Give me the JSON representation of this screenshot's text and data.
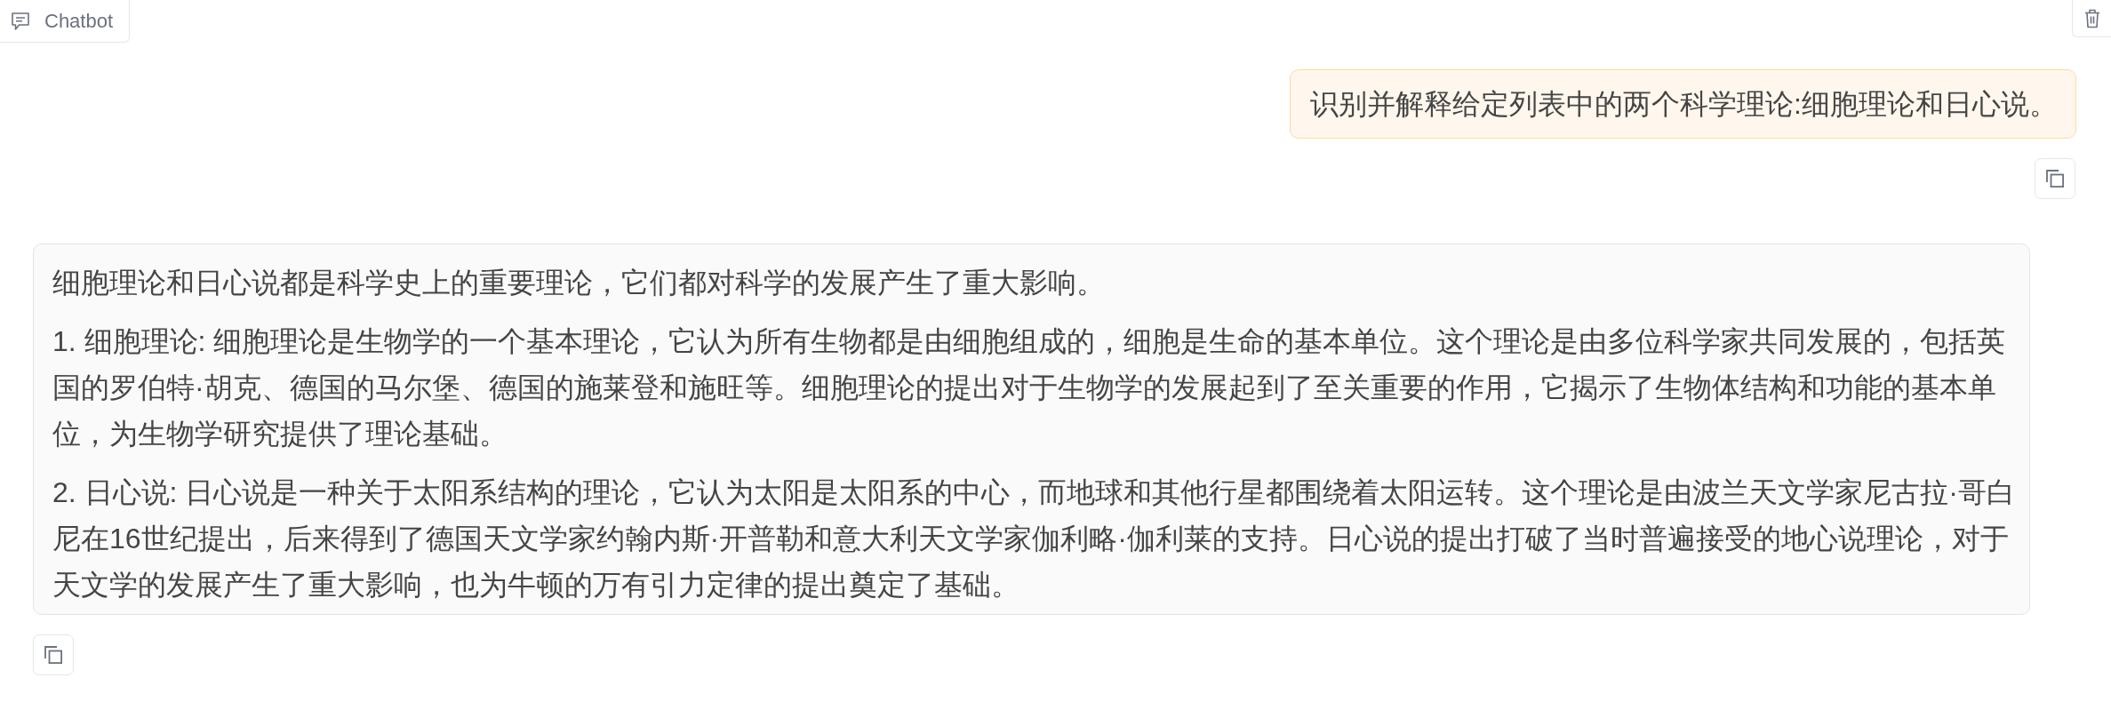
{
  "chatbot": {
    "label": "Chatbot"
  },
  "messages": [
    {
      "kind": "user",
      "paragraphs": [
        "识别并解释给定列表中的两个科学理论:细胞理论和日心说。"
      ]
    },
    {
      "kind": "assistant",
      "paragraphs": [
        "细胞理论和日心说都是科学史上的重要理论，它们都对科学的发展产生了重大影响。",
        "1. 细胞理论: 细胞理论是生物学的一个基本理论，它认为所有生物都是由细胞组成的，细胞是生命的基本单位。这个理论是由多位科学家共同发展的，包括英国的罗伯特·胡克、德国的马尔堡、德国的施莱登和施旺等。细胞理论的提出对于生物学的发展起到了至关重要的作用，它揭示了生物体结构和功能的基本单位，为生物学研究提供了理论基础。",
        "2. 日心说: 日心说是一种关于太阳系结构的理论，它认为太阳是太阳系的中心，而地球和其他行星都围绕着太阳运转。这个理论是由波兰天文学家尼古拉·哥白尼在16世纪提出，后来得到了德国天文学家约翰内斯·开普勒和意大利天文学家伽利略·伽利莱的支持。日心说的提出打破了当时普遍接受的地心说理论，对于天文学的发展产生了重大影响，也为牛顿的万有引力定律的提出奠定了基础。"
      ]
    }
  ]
}
